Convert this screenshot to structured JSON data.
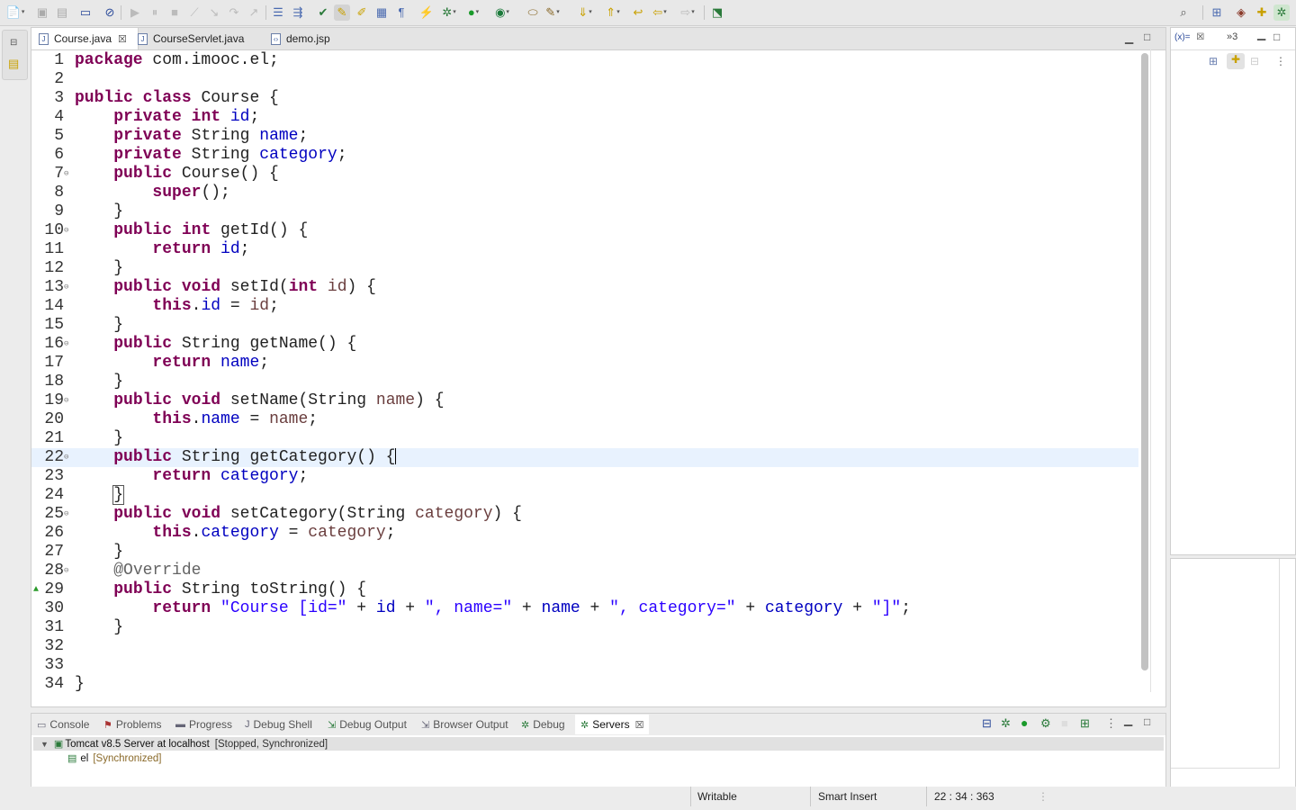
{
  "toolbar": {
    "icons": [
      "new-icon",
      "save-icon",
      "save-all-icon",
      "console-icon",
      "skip-breakpoints-icon",
      "resume-icon",
      "suspend-icon",
      "terminate-icon",
      "disconnect-icon",
      "step-into-icon",
      "step-over-icon",
      "step-return-icon",
      "drop-to-frame-icon",
      "toggle-mark-icon",
      "highlight-icon",
      "block-selection-icon",
      "show-whitespace-icon",
      "debug-icon",
      "run-icon",
      "coverage-icon",
      "open-type-icon",
      "search-icon",
      "next-annotation-icon",
      "prev-annotation-icon",
      "last-edit-icon",
      "back-icon",
      "forward-icon",
      "pin-editor-icon"
    ],
    "right_icons": [
      "search-icon",
      "open-perspective-icon",
      "java-ee-perspective-icon",
      "java-perspective-icon",
      "debug-perspective-icon"
    ]
  },
  "editor": {
    "tabs": [
      {
        "label": "Course.java",
        "active": true,
        "closable": true
      },
      {
        "label": "CourseServlet.java",
        "active": false,
        "closable": false
      },
      {
        "label": "demo.jsp",
        "active": false,
        "closable": false
      }
    ],
    "lines": [
      {
        "n": "1",
        "fold": "",
        "tokens": [
          [
            "k",
            "package"
          ],
          [
            "t",
            " com.imooc.el;"
          ]
        ]
      },
      {
        "n": "2",
        "fold": "",
        "tokens": []
      },
      {
        "n": "3",
        "fold": "",
        "tokens": [
          [
            "k",
            "public"
          ],
          [
            "t",
            " "
          ],
          [
            "k",
            "class"
          ],
          [
            "t",
            " Course {"
          ]
        ]
      },
      {
        "n": "4",
        "fold": "",
        "tokens": [
          [
            "t",
            "    "
          ],
          [
            "k",
            "private"
          ],
          [
            "t",
            " "
          ],
          [
            "k",
            "int"
          ],
          [
            "t",
            " "
          ],
          [
            "f",
            "id"
          ],
          [
            "t",
            ";"
          ]
        ]
      },
      {
        "n": "5",
        "fold": "",
        "tokens": [
          [
            "t",
            "    "
          ],
          [
            "k",
            "private"
          ],
          [
            "t",
            " String "
          ],
          [
            "f",
            "name"
          ],
          [
            "t",
            ";"
          ]
        ]
      },
      {
        "n": "6",
        "fold": "",
        "tokens": [
          [
            "t",
            "    "
          ],
          [
            "k",
            "private"
          ],
          [
            "t",
            " String "
          ],
          [
            "f",
            "category"
          ],
          [
            "t",
            ";"
          ]
        ]
      },
      {
        "n": "7",
        "fold": "⊖",
        "tokens": [
          [
            "t",
            "    "
          ],
          [
            "k",
            "public"
          ],
          [
            "t",
            " Course() {"
          ]
        ]
      },
      {
        "n": "8",
        "fold": "",
        "tokens": [
          [
            "t",
            "        "
          ],
          [
            "k",
            "super"
          ],
          [
            "t",
            "();"
          ]
        ]
      },
      {
        "n": "9",
        "fold": "",
        "tokens": [
          [
            "t",
            "    }"
          ]
        ]
      },
      {
        "n": "10",
        "fold": "⊖",
        "tokens": [
          [
            "t",
            "    "
          ],
          [
            "k",
            "public"
          ],
          [
            "t",
            " "
          ],
          [
            "k",
            "int"
          ],
          [
            "t",
            " getId() {"
          ]
        ]
      },
      {
        "n": "11",
        "fold": "",
        "tokens": [
          [
            "t",
            "        "
          ],
          [
            "k",
            "return"
          ],
          [
            "t",
            " "
          ],
          [
            "f",
            "id"
          ],
          [
            "t",
            ";"
          ]
        ]
      },
      {
        "n": "12",
        "fold": "",
        "tokens": [
          [
            "t",
            "    }"
          ]
        ]
      },
      {
        "n": "13",
        "fold": "⊖",
        "tokens": [
          [
            "t",
            "    "
          ],
          [
            "k",
            "public"
          ],
          [
            "t",
            " "
          ],
          [
            "k",
            "void"
          ],
          [
            "t",
            " setId("
          ],
          [
            "k",
            "int"
          ],
          [
            "t",
            " "
          ],
          [
            "p",
            "id"
          ],
          [
            "t",
            ") {"
          ]
        ]
      },
      {
        "n": "14",
        "fold": "",
        "tokens": [
          [
            "t",
            "        "
          ],
          [
            "k",
            "this"
          ],
          [
            "t",
            "."
          ],
          [
            "f",
            "id"
          ],
          [
            "t",
            " = "
          ],
          [
            "p",
            "id"
          ],
          [
            "t",
            ";"
          ]
        ]
      },
      {
        "n": "15",
        "fold": "",
        "tokens": [
          [
            "t",
            "    }"
          ]
        ]
      },
      {
        "n": "16",
        "fold": "⊖",
        "tokens": [
          [
            "t",
            "    "
          ],
          [
            "k",
            "public"
          ],
          [
            "t",
            " String getName() {"
          ]
        ]
      },
      {
        "n": "17",
        "fold": "",
        "tokens": [
          [
            "t",
            "        "
          ],
          [
            "k",
            "return"
          ],
          [
            "t",
            " "
          ],
          [
            "f",
            "name"
          ],
          [
            "t",
            ";"
          ]
        ]
      },
      {
        "n": "18",
        "fold": "",
        "tokens": [
          [
            "t",
            "    }"
          ]
        ]
      },
      {
        "n": "19",
        "fold": "⊖",
        "tokens": [
          [
            "t",
            "    "
          ],
          [
            "k",
            "public"
          ],
          [
            "t",
            " "
          ],
          [
            "k",
            "void"
          ],
          [
            "t",
            " setName(String "
          ],
          [
            "p",
            "name"
          ],
          [
            "t",
            ") {"
          ]
        ]
      },
      {
        "n": "20",
        "fold": "",
        "tokens": [
          [
            "t",
            "        "
          ],
          [
            "k",
            "this"
          ],
          [
            "t",
            "."
          ],
          [
            "f",
            "name"
          ],
          [
            "t",
            " = "
          ],
          [
            "p",
            "name"
          ],
          [
            "t",
            ";"
          ]
        ]
      },
      {
        "n": "21",
        "fold": "",
        "tokens": [
          [
            "t",
            "    }"
          ]
        ]
      },
      {
        "n": "22",
        "fold": "⊖",
        "tokens": [
          [
            "t",
            "    "
          ],
          [
            "k",
            "public"
          ],
          [
            "t",
            " String getCategory() {"
          ],
          [
            "caret",
            ""
          ]
        ]
      },
      {
        "n": "23",
        "fold": "",
        "tokens": [
          [
            "t",
            "        "
          ],
          [
            "k",
            "return"
          ],
          [
            "t",
            " "
          ],
          [
            "f",
            "category"
          ],
          [
            "t",
            ";"
          ]
        ]
      },
      {
        "n": "24",
        "fold": "",
        "tokens": [
          [
            "t",
            "    "
          ],
          [
            "box",
            "}"
          ]
        ]
      },
      {
        "n": "25",
        "fold": "⊖",
        "tokens": [
          [
            "t",
            "    "
          ],
          [
            "k",
            "public"
          ],
          [
            "t",
            " "
          ],
          [
            "k",
            "void"
          ],
          [
            "t",
            " setCategory(String "
          ],
          [
            "p",
            "category"
          ],
          [
            "t",
            ") {"
          ]
        ]
      },
      {
        "n": "26",
        "fold": "",
        "tokens": [
          [
            "t",
            "        "
          ],
          [
            "k",
            "this"
          ],
          [
            "t",
            "."
          ],
          [
            "f",
            "category"
          ],
          [
            "t",
            " = "
          ],
          [
            "p",
            "category"
          ],
          [
            "t",
            ";"
          ]
        ]
      },
      {
        "n": "27",
        "fold": "",
        "tokens": [
          [
            "t",
            "    }"
          ]
        ]
      },
      {
        "n": "28",
        "fold": "⊖",
        "tokens": [
          [
            "t",
            "    "
          ],
          [
            "a",
            "@Override"
          ]
        ]
      },
      {
        "n": "29",
        "fold": "",
        "tokens": [
          [
            "t",
            "    "
          ],
          [
            "k",
            "public"
          ],
          [
            "t",
            " String toString() {"
          ]
        ]
      },
      {
        "n": "30",
        "fold": "",
        "tokens": [
          [
            "t",
            "        "
          ],
          [
            "k",
            "return"
          ],
          [
            "t",
            " "
          ],
          [
            "s",
            "\"Course [id=\""
          ],
          [
            "t",
            " + "
          ],
          [
            "f",
            "id"
          ],
          [
            "t",
            " + "
          ],
          [
            "s",
            "\", name=\""
          ],
          [
            "t",
            " + "
          ],
          [
            "f",
            "name"
          ],
          [
            "t",
            " + "
          ],
          [
            "s",
            "\", category=\""
          ],
          [
            "t",
            " + "
          ],
          [
            "f",
            "category"
          ],
          [
            "t",
            " + "
          ],
          [
            "s",
            "\"]\""
          ],
          [
            "t",
            ";"
          ]
        ]
      },
      {
        "n": "31",
        "fold": "",
        "tokens": [
          [
            "t",
            "    }"
          ]
        ]
      },
      {
        "n": "32",
        "fold": "",
        "tokens": []
      },
      {
        "n": "33",
        "fold": "",
        "tokens": []
      },
      {
        "n": "34",
        "fold": "",
        "tokens": [
          [
            "t",
            "}"
          ]
        ]
      }
    ],
    "current_line": "22",
    "override_marker_line": "29"
  },
  "right_panel": {
    "tab_label": "(x)=",
    "overflow_label": "»3"
  },
  "bottom_panel": {
    "tabs": [
      {
        "label": "Console",
        "icon": "console-icon",
        "active": false
      },
      {
        "label": "Problems",
        "icon": "problems-icon",
        "active": false
      },
      {
        "label": "Progress",
        "icon": "progress-icon",
        "active": false
      },
      {
        "label": "Debug Shell",
        "icon": "debug-shell-icon",
        "active": false
      },
      {
        "label": "Debug Output",
        "icon": "debug-output-icon",
        "active": false
      },
      {
        "label": "Browser Output",
        "icon": "browser-output-icon",
        "active": false
      },
      {
        "label": "Debug",
        "icon": "debug-icon",
        "active": false
      },
      {
        "label": "Servers",
        "icon": "servers-icon",
        "active": true
      }
    ],
    "server": {
      "name": "Tomcat v8.5 Server at localhost",
      "state": "[Stopped, Synchronized]"
    },
    "module": {
      "name": "el",
      "state": "[Synchronized]"
    }
  },
  "status_bar": {
    "writable": "Writable",
    "insert_mode": "Smart Insert",
    "position": "22 : 34 : 363"
  },
  "colors": {
    "keyword": "#7f0055",
    "field": "#0000c0",
    "string": "#2a00ff",
    "parameter": "#6a3e3e",
    "annotation": "#646464",
    "current_line": "#e8f2fe"
  }
}
